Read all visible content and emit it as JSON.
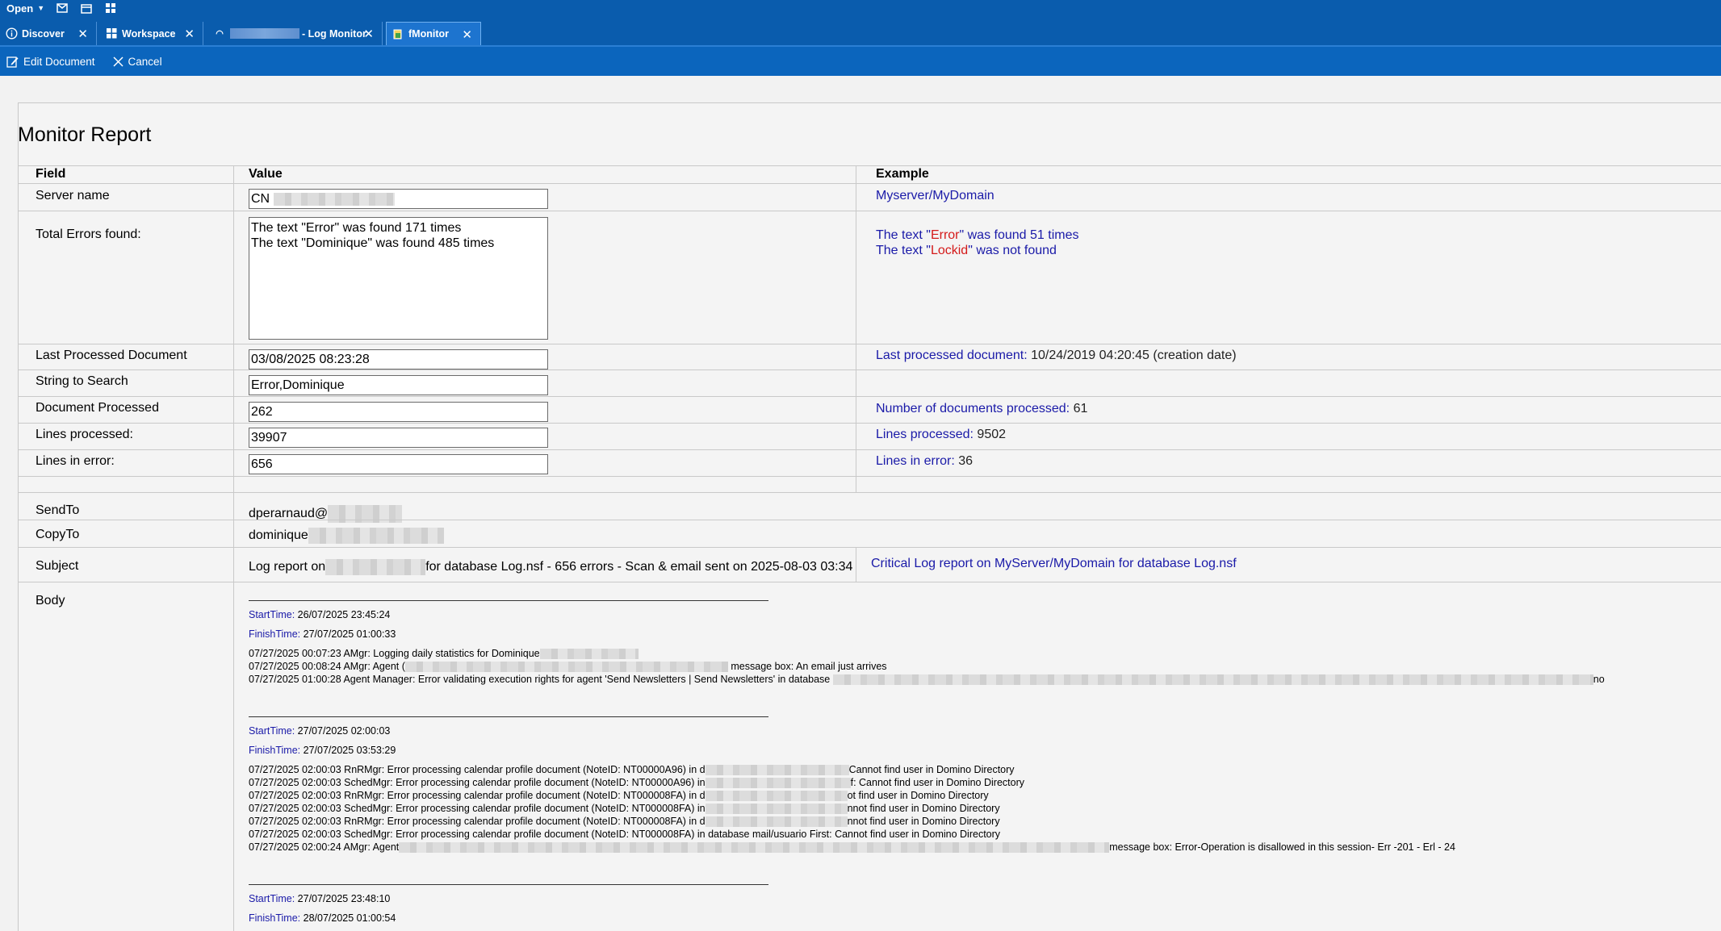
{
  "menubar": {
    "open_label": "Open"
  },
  "tabs": [
    {
      "label": "Discover"
    },
    {
      "label": "Workspace"
    },
    {
      "label": "- Log Monitor"
    },
    {
      "label": "fMonitor"
    }
  ],
  "toolbar": {
    "edit_label": "Edit Document",
    "cancel_label": "Cancel"
  },
  "report": {
    "title": "Monitor Report",
    "headers": {
      "field": "Field",
      "value": "Value",
      "example": "Example"
    },
    "server_name": {
      "label": "Server name",
      "value": "CN",
      "example": "Myserver/MyDomain"
    },
    "total_errors": {
      "label": "Total Errors found:",
      "value_line1": "The text \"Error\" was found 171 times",
      "value_line2": "The text \"Dominique\" was found 485 times",
      "ex1_a": "The text \"",
      "ex1_b": "Error",
      "ex1_c": "\" was found 51 times",
      "ex2_a": "The text \"",
      "ex2_b": "Lockid",
      "ex2_c": "\" was not found"
    },
    "last_processed": {
      "label": "Last Processed  Document",
      "value": "03/08/2025 08:23:28",
      "ex_label": "Last processed document:",
      "ex_value": "10/24/2019 04:20:45 (creation date)"
    },
    "string_to_search": {
      "label": "String to Search",
      "value": "Error,Dominique"
    },
    "doc_processed": {
      "label": "Document Processed",
      "value": "262",
      "ex_label": "Number of documents processed:",
      "ex_value": "61"
    },
    "lines_processed": {
      "label": "Lines processed:",
      "value": "39907",
      "ex_label": "Lines processed:",
      "ex_value": "9502"
    },
    "lines_error": {
      "label": "Lines in error:",
      "value": "656",
      "ex_label": "Lines in error:",
      "ex_value": "36"
    },
    "sendto": {
      "label": "SendTo",
      "value": "dperarnaud@"
    },
    "copyto": {
      "label": "CopyTo",
      "value": "dominique"
    },
    "subject": {
      "label": "Subject",
      "value_a": "Log report on",
      "value_b": "for database Log.nsf - 656 errors - Scan & email sent on 2025-08-03 03:34",
      "example": "Critical Log report on MyServer/MyDomain for database Log.nsf"
    },
    "body": {
      "label": "Body",
      "blocks": [
        {
          "start_label": "StartTime:",
          "start": "26/07/2025 23:45:24",
          "finish_label": "FinishTime:",
          "finish": "27/07/2025 01:00:33",
          "lines": [
            {
              "a": "07/27/2025 00:07:23   AMgr: Logging daily statistics for Dominique",
              "b": ""
            },
            {
              "a": "07/27/2025 00:08:24   AMgr: Agent (",
              "b": "message box: An email just arrives"
            },
            {
              "a": "07/27/2025 01:00:28   Agent Manager: Error validating execution rights for agent 'Send Newsletters | Send Newsletters' in database",
              "b": "no"
            }
          ]
        },
        {
          "start_label": "StartTime:",
          "start": "27/07/2025 02:00:03",
          "finish_label": "FinishTime:",
          "finish": "27/07/2025 03:53:29",
          "lines": [
            {
              "a": "07/27/2025 02:00:03   RnRMgr: Error processing calendar profile document (NoteID: NT00000A96) in d",
              "b": "Cannot find user in Domino Directory"
            },
            {
              "a": "07/27/2025 02:00:03   SchedMgr: Error processing calendar profile document (NoteID: NT00000A96) in",
              "b": "f: Cannot find user in Domino Directory"
            },
            {
              "a": "07/27/2025 02:00:03   RnRMgr: Error processing calendar profile document (NoteID: NT000008FA) in d",
              "b": "ot find user in Domino Directory"
            },
            {
              "a": "07/27/2025 02:00:03   SchedMgr: Error processing calendar profile document (NoteID: NT000008FA) in",
              "b": "nnot find user in Domino Directory"
            },
            {
              "a": "07/27/2025 02:00:03   RnRMgr: Error processing calendar profile document (NoteID: NT000008FA) in d",
              "b": "nnot find user in Domino Directory"
            },
            {
              "a": "07/27/2025 02:00:03   SchedMgr: Error processing calendar profile document (NoteID: NT000008FA) in database mail/usuario First: Cannot find user in Domino Directory",
              "b": ""
            },
            {
              "a": "07/27/2025 02:00:24   AMgr: Agent",
              "b": "message box: Error-Operation is disallowed in this session- Err -201 - Erl - 24"
            }
          ]
        },
        {
          "start_label": "StartTime:",
          "start": "27/07/2025 23:48:10",
          "finish_label": "FinishTime:",
          "finish": "28/07/2025 01:00:54",
          "lines": []
        }
      ]
    }
  }
}
